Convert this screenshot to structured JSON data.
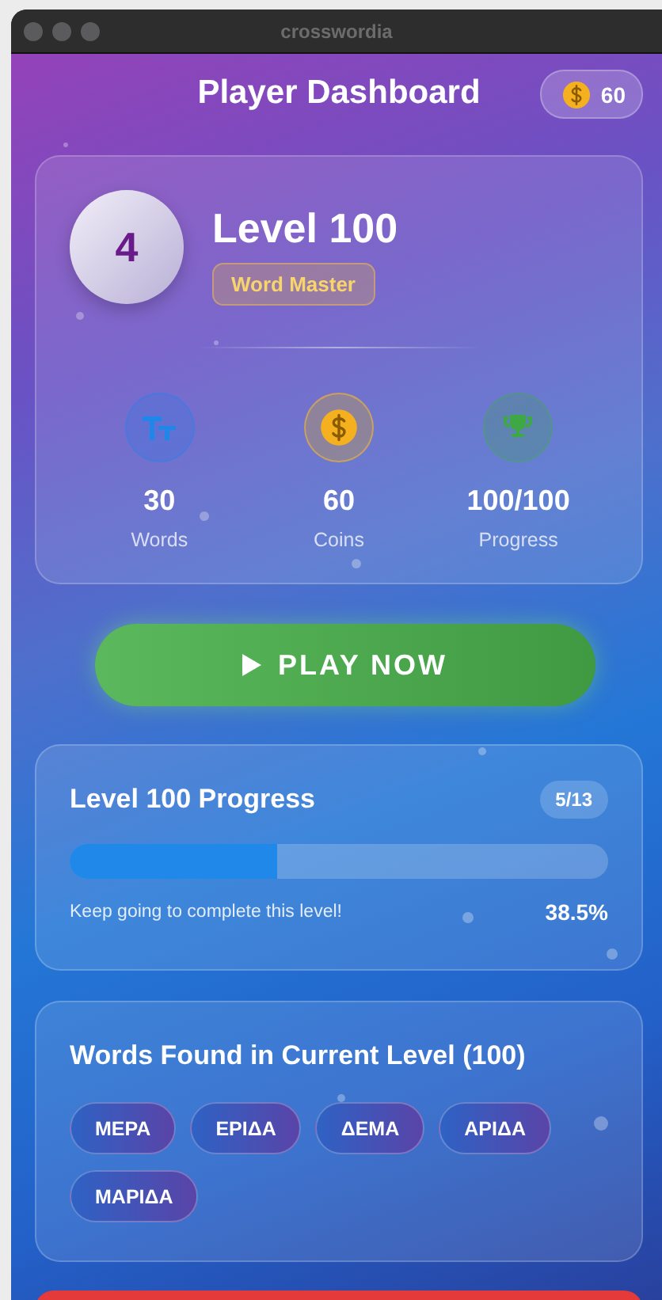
{
  "window": {
    "title": "crosswordia"
  },
  "header": {
    "title": "Player Dashboard",
    "coins": "60"
  },
  "player": {
    "avatar_letter": "4",
    "level_title": "Level 100",
    "rank_badge": "Word Master"
  },
  "stats": [
    {
      "kind": "words",
      "value": "30",
      "label": "Words"
    },
    {
      "kind": "coins",
      "value": "60",
      "label": "Coins"
    },
    {
      "kind": "progress",
      "value": "100/100",
      "label": "Progress"
    }
  ],
  "play_button": {
    "label": "PLAY NOW"
  },
  "level_progress": {
    "title": "Level 100 Progress",
    "count": "5/13",
    "level": 0.385,
    "message": "Keep going to complete this level!",
    "percent": "38.5%"
  },
  "words_found": {
    "title": "Words Found in Current Level (100)",
    "words": [
      "ΜΕΡΑ",
      "ΕΡΙΔΑ",
      "ΔΕΜΑ",
      "ΑΡΙΔΑ",
      "ΜΑΡΙΔΑ"
    ]
  }
}
